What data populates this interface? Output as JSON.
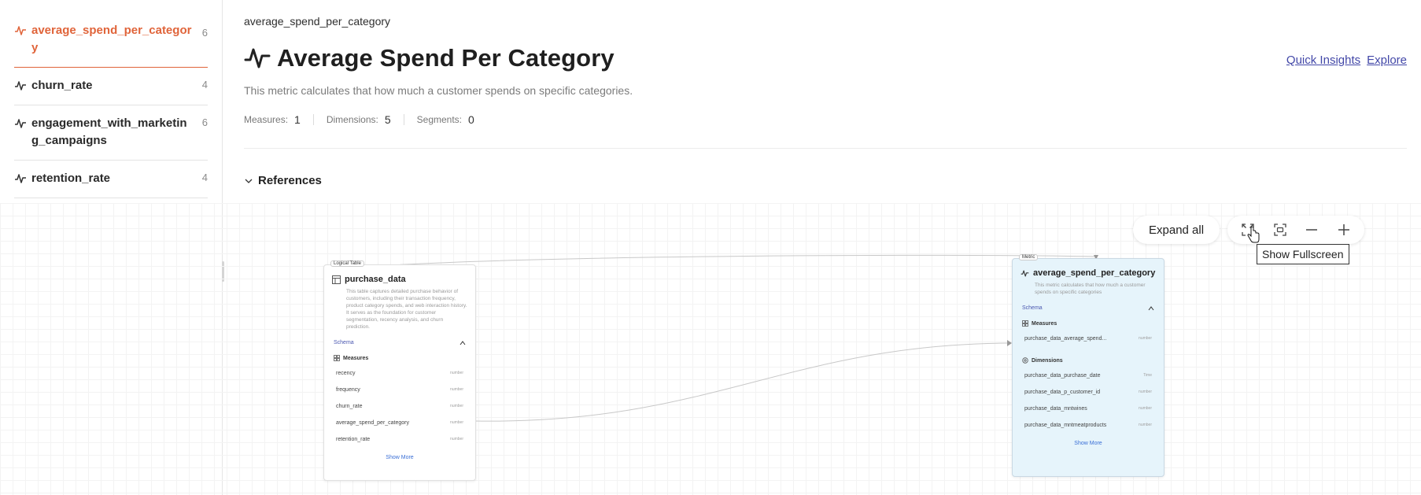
{
  "sidebar": {
    "items": [
      {
        "label": "average_spend_per_category",
        "count": "6"
      },
      {
        "label": "churn_rate",
        "count": "4"
      },
      {
        "label": "engagement_with_marketing_campaigns",
        "count": "6"
      },
      {
        "label": "retention_rate",
        "count": "4"
      }
    ]
  },
  "header": {
    "breadcrumb": "average_spend_per_category",
    "title": "Average Spend Per Category",
    "description": "This metric calculates that how much a customer spends on specific categories.",
    "stats": [
      {
        "label": "Measures:",
        "value": "1"
      },
      {
        "label": "Dimensions:",
        "value": "5"
      },
      {
        "label": "Segments:",
        "value": "0"
      }
    ],
    "links": {
      "quick_insights": "Quick Insights",
      "explore": "Explore"
    },
    "references_label": "References"
  },
  "canvas": {
    "expand_all": "Expand all",
    "tooltip": "Show Fullscreen",
    "toolbar_icons": [
      "fullscreen-icon",
      "fit-view-icon",
      "zoom-out-icon",
      "zoom-in-icon"
    ]
  },
  "logical_table": {
    "tag": "Logical Table",
    "name": "purchase_data",
    "description": "This table captures detailed purchase behavior of customers, including their transaction frequency, product category spends, and web interaction history. It serves as the foundation for customer segmentation, recency analysis, and churn prediction.",
    "schema_label": "Schema",
    "measures_label": "Measures",
    "measures": [
      {
        "name": "recency",
        "type": "number"
      },
      {
        "name": "frequency",
        "type": "number"
      },
      {
        "name": "churn_rate",
        "type": "number"
      },
      {
        "name": "average_spend_per_category",
        "type": "number"
      },
      {
        "name": "retention_rate",
        "type": "number"
      }
    ],
    "show_more": "Show More"
  },
  "metric_node": {
    "tag": "Metric",
    "name": "average_spend_per_category",
    "description": "This metric calculates that how much a customer spends on specific categories",
    "schema_label": "Schema",
    "measures_label": "Measures",
    "measures": [
      {
        "name": "purchase_data_average_spend...",
        "type": "number"
      }
    ],
    "dimensions_label": "Dimensions",
    "dimensions": [
      {
        "name": "purchase_data_purchase_date",
        "type": "Time"
      },
      {
        "name": "purchase_data_p_customer_id",
        "type": "number"
      },
      {
        "name": "purchase_data_mntwines",
        "type": "number"
      },
      {
        "name": "purchase_data_mntmeatproducts",
        "type": "number"
      }
    ],
    "show_more": "Show More"
  },
  "colors": {
    "accent": "#e0643a",
    "link": "#4348a8",
    "metric_bg": "#e6f4fb"
  }
}
